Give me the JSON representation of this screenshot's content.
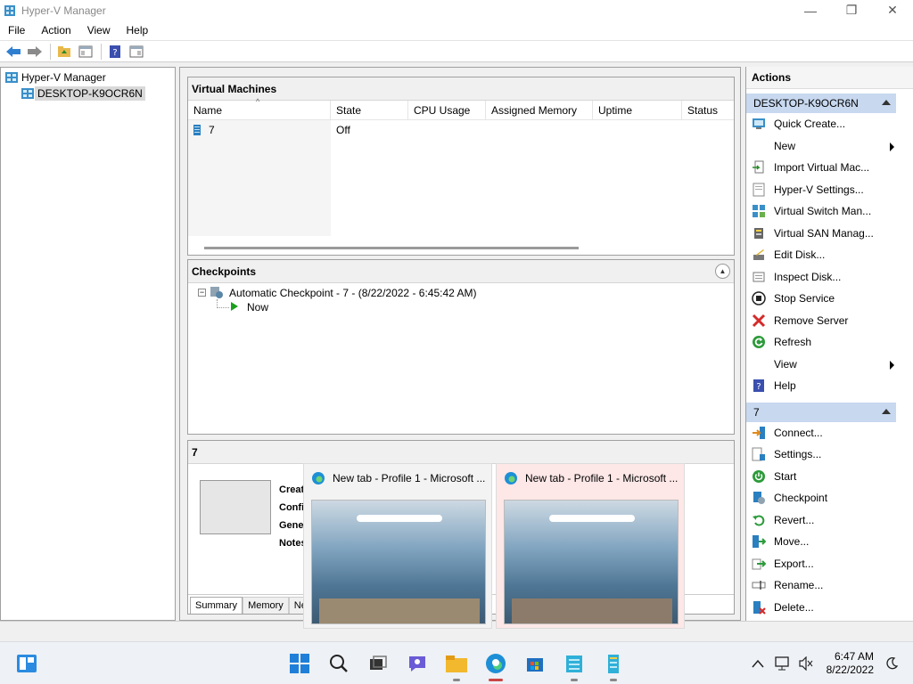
{
  "window": {
    "title": "Hyper-V Manager",
    "controls": {
      "minimize": "—",
      "maximize": "❐",
      "close": "✕"
    }
  },
  "menu": [
    "File",
    "Action",
    "View",
    "Help"
  ],
  "tree": {
    "root": "Hyper-V Manager",
    "server": "DESKTOP-K9OCR6N"
  },
  "vm_panel": {
    "title": "Virtual Machines",
    "columns": [
      "Name",
      "State",
      "CPU Usage",
      "Assigned Memory",
      "Uptime",
      "Status"
    ],
    "rows": [
      {
        "name": "7",
        "state": "Off"
      }
    ]
  },
  "checkpoints": {
    "title": "Checkpoints",
    "items": [
      "Automatic Checkpoint - 7 - (8/22/2022 - 6:45:42 AM)",
      "Now"
    ]
  },
  "details": {
    "title": "7",
    "fields": [
      "Creat",
      "Confi",
      "Gene",
      "Notes"
    ],
    "tabs": [
      "Summary",
      "Memory",
      "Netv"
    ]
  },
  "actions": {
    "title": "Actions",
    "server_group": "DESKTOP-K9OCR6N",
    "server_actions": [
      {
        "label": "Quick Create...",
        "icon": "quick-create-icon",
        "submenu": false
      },
      {
        "label": "New",
        "icon": "",
        "submenu": true
      },
      {
        "label": "Import Virtual Mac...",
        "icon": "import-icon",
        "submenu": false
      },
      {
        "label": "Hyper-V Settings...",
        "icon": "settings-page-icon",
        "submenu": false
      },
      {
        "label": "Virtual Switch Man...",
        "icon": "switch-icon",
        "submenu": false
      },
      {
        "label": "Virtual SAN Manag...",
        "icon": "san-icon",
        "submenu": false
      },
      {
        "label": "Edit Disk...",
        "icon": "edit-disk-icon",
        "submenu": false
      },
      {
        "label": "Inspect Disk...",
        "icon": "inspect-disk-icon",
        "submenu": false
      },
      {
        "label": "Stop Service",
        "icon": "stop-icon",
        "submenu": false
      },
      {
        "label": "Remove Server",
        "icon": "remove-icon",
        "submenu": false
      },
      {
        "label": "Refresh",
        "icon": "refresh-icon",
        "submenu": false
      },
      {
        "label": "View",
        "icon": "",
        "submenu": true
      },
      {
        "label": "Help",
        "icon": "help-icon",
        "submenu": false
      }
    ],
    "vm_group": "7",
    "vm_actions": [
      {
        "label": "Connect...",
        "icon": "connect-icon"
      },
      {
        "label": "Settings...",
        "icon": "vm-settings-icon"
      },
      {
        "label": "Start",
        "icon": "power-icon"
      },
      {
        "label": "Checkpoint",
        "icon": "checkpoint-icon"
      },
      {
        "label": "Revert...",
        "icon": "revert-icon"
      },
      {
        "label": "Move...",
        "icon": "move-icon"
      },
      {
        "label": "Export...",
        "icon": "export-icon"
      },
      {
        "label": "Rename...",
        "icon": "rename-icon"
      },
      {
        "label": "Delete...",
        "icon": "delete-icon"
      }
    ]
  },
  "previews": [
    {
      "title": "New tab - Profile 1 - Microsoft ..."
    },
    {
      "title": "New tab - Profile 1 - Microsoft ..."
    }
  ],
  "taskbar": {
    "time": "6:47 AM",
    "date": "8/22/2022"
  }
}
